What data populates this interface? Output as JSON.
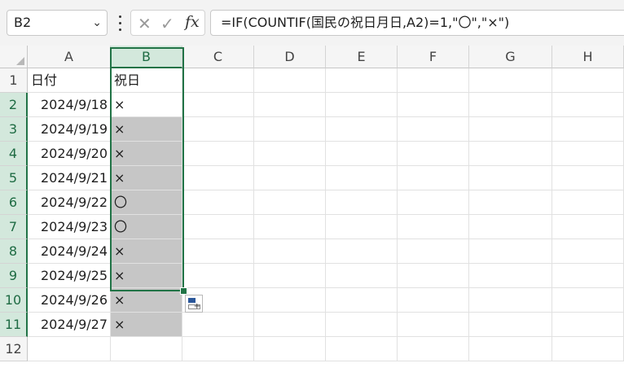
{
  "name_box": {
    "value": "B2"
  },
  "formula_bar": {
    "cancel_glyph": "✕",
    "enter_glyph": "✓",
    "fx_label": "fx",
    "formula": "=IF(COUNTIF(国民の祝日月日,A2)=1,\"〇\",\"×\")"
  },
  "columns": [
    "A",
    "B",
    "C",
    "D",
    "E",
    "F",
    "G",
    "H"
  ],
  "selected_column": "B",
  "rows": [
    {
      "num": "1",
      "a": "日付",
      "b": "祝日"
    },
    {
      "num": "2",
      "a": "2024/9/18",
      "b": "×"
    },
    {
      "num": "3",
      "a": "2024/9/19",
      "b": "×"
    },
    {
      "num": "4",
      "a": "2024/9/20",
      "b": "×"
    },
    {
      "num": "5",
      "a": "2024/9/21",
      "b": "×"
    },
    {
      "num": "6",
      "a": "2024/9/22",
      "b": "〇"
    },
    {
      "num": "7",
      "a": "2024/9/23",
      "b": "〇"
    },
    {
      "num": "8",
      "a": "2024/9/24",
      "b": "×"
    },
    {
      "num": "9",
      "a": "2024/9/25",
      "b": "×"
    },
    {
      "num": "10",
      "a": "2024/9/26",
      "b": "×"
    },
    {
      "num": "11",
      "a": "2024/9/27",
      "b": "×"
    },
    {
      "num": "12",
      "a": "",
      "b": ""
    }
  ],
  "colors": {
    "selection": "#217346",
    "highlight": "#c6c6c6",
    "header_selected": "#d3e8dc"
  }
}
